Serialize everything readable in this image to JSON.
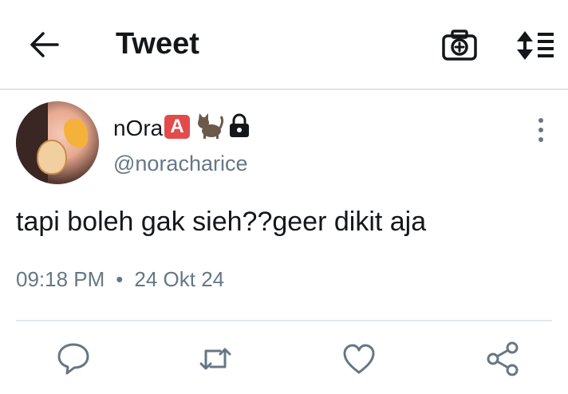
{
  "header": {
    "title": "Tweet",
    "icons": [
      "back-arrow-icon",
      "camera-icon",
      "sort-icon"
    ]
  },
  "tweet": {
    "author": {
      "display_name": "nOra",
      "emoji_badge": "A",
      "handle": "@noracharice"
    },
    "text": "tapi boleh gak sieh??geer dikit aja",
    "time": "09:18 PM",
    "separator": "•",
    "date": "24 Okt 24"
  },
  "actions": [
    "reply-icon",
    "retweet-icon",
    "like-icon",
    "share-icon"
  ],
  "colors": {
    "text_primary": "#14171a",
    "text_secondary": "#657786",
    "divider": "#e1e8ed",
    "icon_gray": "#657786"
  }
}
